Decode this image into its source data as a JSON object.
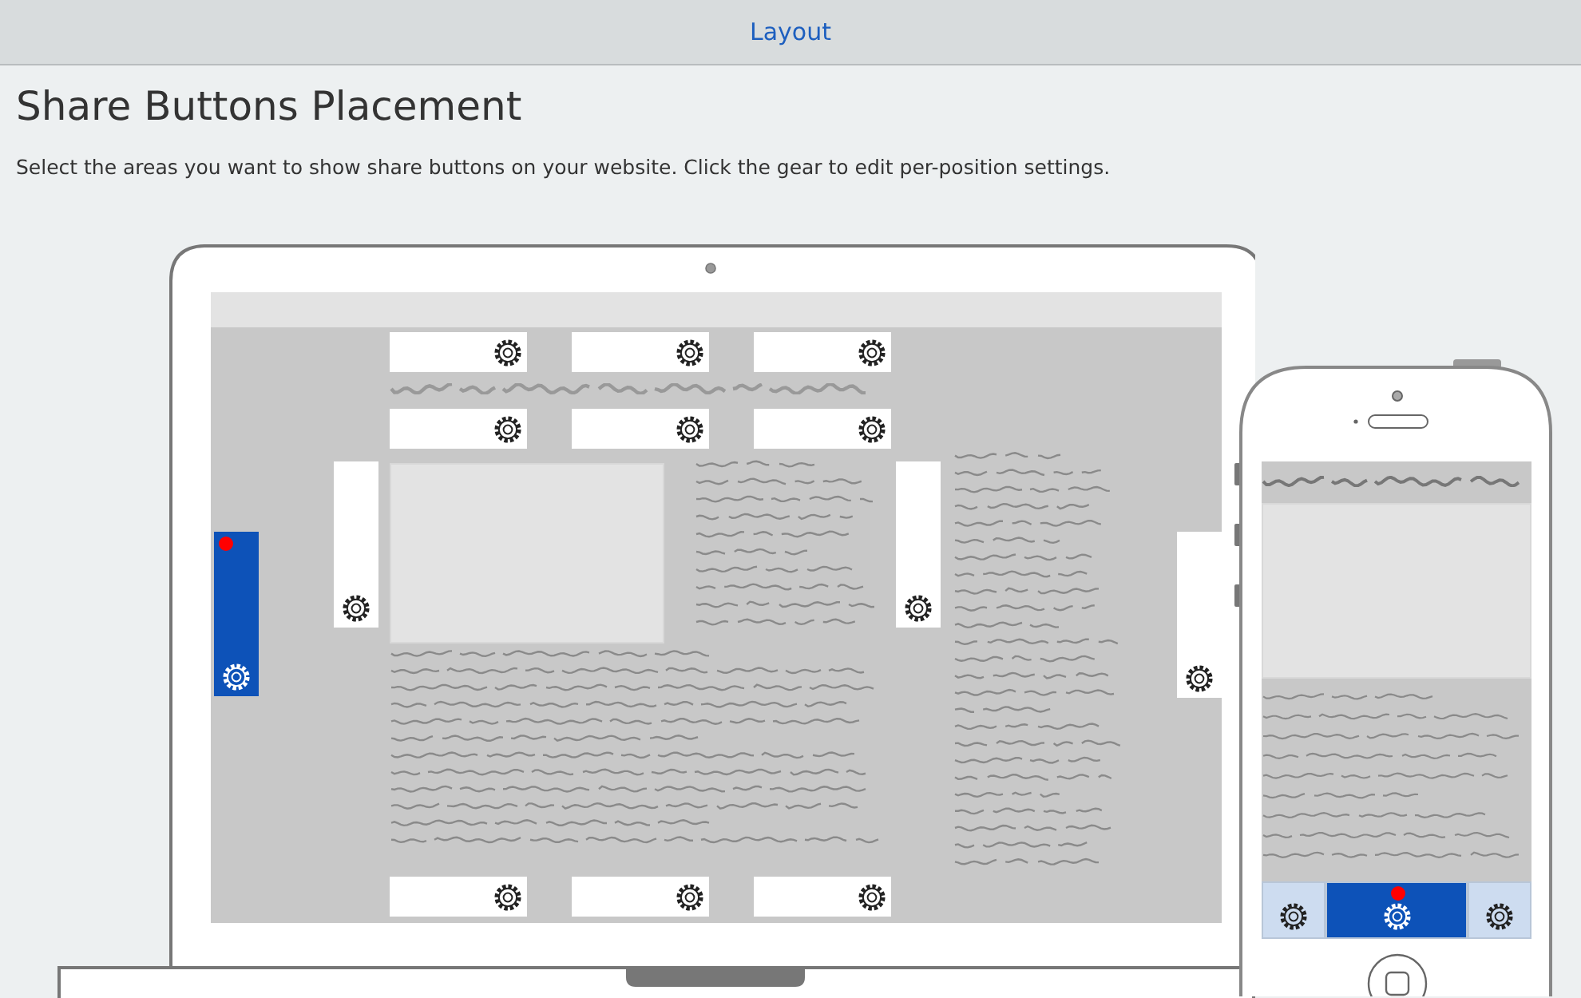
{
  "header": {
    "title": "Layout"
  },
  "heading": "Share Buttons Placement",
  "description": "Select the areas you want to show share buttons on your website. Click the gear to edit per-position settings.",
  "desktop_slots": [
    {
      "kind": "horizontal",
      "selected": false
    },
    {
      "kind": "horizontal",
      "selected": false
    },
    {
      "kind": "horizontal",
      "selected": false
    },
    {
      "kind": "horizontal",
      "selected": false
    },
    {
      "kind": "horizontal",
      "selected": false
    },
    {
      "kind": "horizontal",
      "selected": false
    },
    {
      "kind": "vertical",
      "selected": true
    },
    {
      "kind": "vertical",
      "selected": false
    },
    {
      "kind": "vertical",
      "selected": false
    },
    {
      "kind": "vertical",
      "selected": false
    },
    {
      "kind": "horizontal",
      "selected": false
    },
    {
      "kind": "horizontal",
      "selected": false
    },
    {
      "kind": "horizontal",
      "selected": false
    }
  ],
  "mobile_slots": [
    {
      "selected": false
    },
    {
      "selected": true
    },
    {
      "selected": false
    }
  ]
}
